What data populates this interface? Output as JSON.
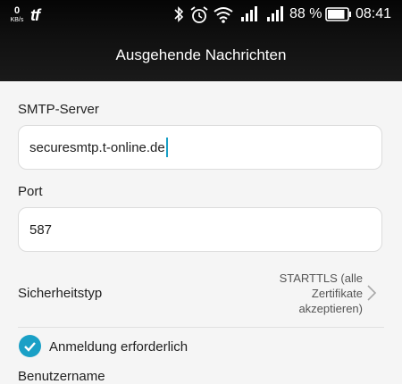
{
  "status_bar": {
    "net_speed_value": "0",
    "net_speed_unit": "KB/s",
    "app_logo": "tf",
    "icons": [
      "bluetooth-icon",
      "alarm-icon",
      "wifi-icon",
      "signal-icon",
      "signal-icon",
      "battery-icon"
    ],
    "battery_percent": "88 %",
    "battery_level": 0.88,
    "time": "08:41"
  },
  "header": {
    "title": "Ausgehende Nachrichten"
  },
  "form": {
    "smtp_label": "SMTP-Server",
    "smtp_value": "securesmtp.t-online.de",
    "port_label": "Port",
    "port_value": "587",
    "security_label": "Sicherheitstyp",
    "security_value": "STARTTLS (alle Zertifikate akzeptieren)",
    "auth_label": "Anmeldung erforderlich",
    "auth_checked": true,
    "username_label": "Benutzername"
  },
  "colors": {
    "accent": "#1aa0c6",
    "header_bg": "#111111",
    "page_bg": "#f5f5f5"
  }
}
